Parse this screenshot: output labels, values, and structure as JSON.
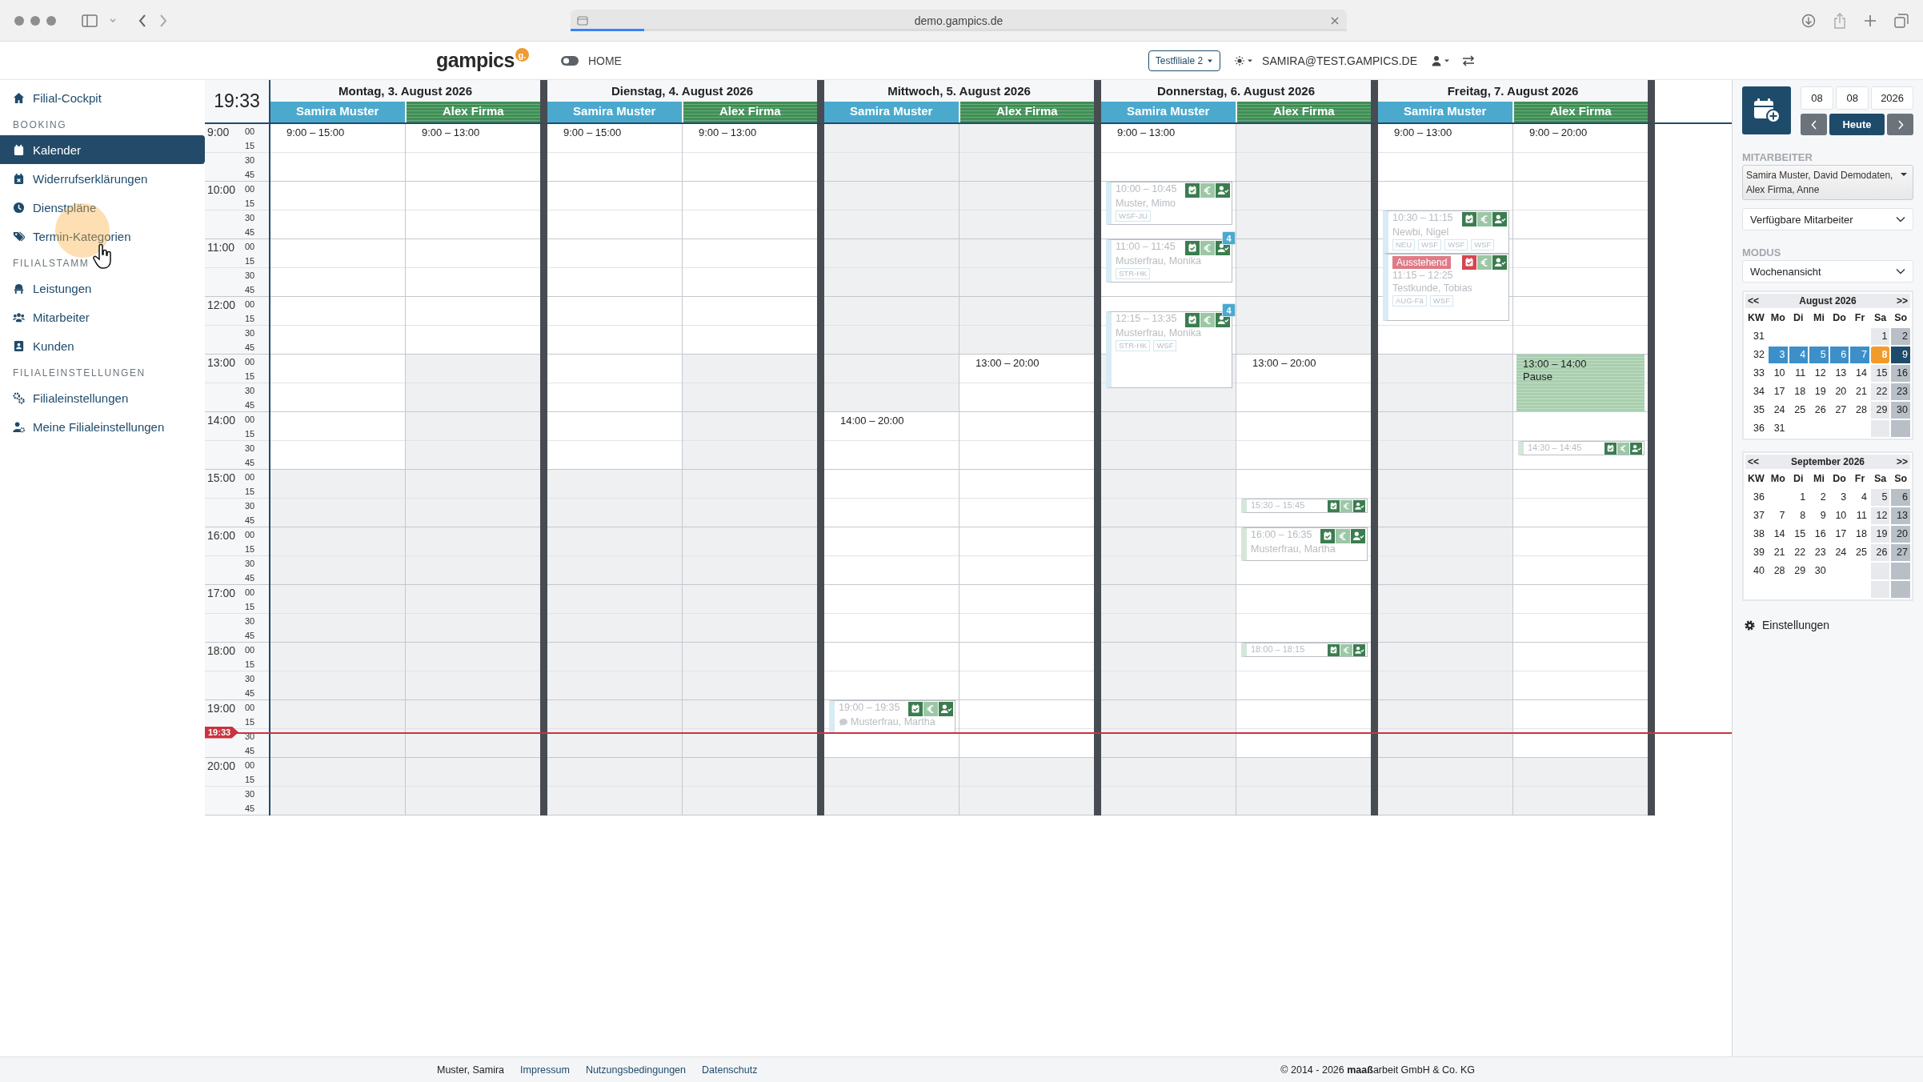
{
  "browser": {
    "url": "demo.gampics.de",
    "loading": {
      "level": 0.095
    }
  },
  "header": {
    "logo": "gampics",
    "logo_badge": "g.",
    "toggle_on": false,
    "mode_label": "HOME",
    "branch": "Testfiliale 2",
    "user": "SAMIRA@TEST.GAMPICS.DE"
  },
  "sidebar": {
    "items": [
      {
        "kind": "link",
        "label": "Filial-Cockpit",
        "selected": false
      },
      {
        "kind": "section",
        "label": "BOOKING"
      },
      {
        "kind": "link",
        "label": "Kalender",
        "selected": true
      },
      {
        "kind": "link",
        "label": "Widerrufserklärungen",
        "selected": false
      },
      {
        "kind": "link",
        "label": "Dienstpläne",
        "selected": false
      },
      {
        "kind": "link",
        "label": "Termin-Kategorien",
        "selected": false
      },
      {
        "kind": "section",
        "label": "FILIALSTAMM"
      },
      {
        "kind": "link",
        "label": "Leistungen",
        "selected": false
      },
      {
        "kind": "link",
        "label": "Mitarbeiter",
        "selected": false
      },
      {
        "kind": "link",
        "label": "Kunden",
        "selected": false
      },
      {
        "kind": "section",
        "label": "FILIALEINSTELLUNGEN"
      },
      {
        "kind": "link",
        "label": "Filialeinstellungen",
        "selected": false
      },
      {
        "kind": "link",
        "label": "Meine Filialeinstellungen",
        "selected": false
      }
    ]
  },
  "calendar": {
    "now": "19:33",
    "now_marker": "19:33",
    "hours": [
      {
        "label": "9:00",
        "quarters": [
          "00",
          "15",
          "30",
          "45"
        ]
      },
      {
        "label": "10:00",
        "quarters": [
          "00",
          "15",
          "30",
          "45"
        ]
      },
      {
        "label": "11:00",
        "quarters": [
          "00",
          "15",
          "30",
          "45"
        ]
      },
      {
        "label": "12:00",
        "quarters": [
          "00",
          "15",
          "30",
          "45"
        ]
      },
      {
        "label": "13:00",
        "quarters": [
          "00",
          "15",
          "30",
          "45"
        ]
      },
      {
        "label": "14:00",
        "quarters": [
          "00",
          "15",
          "30",
          "45"
        ]
      },
      {
        "label": "15:00",
        "quarters": [
          "00",
          "15",
          "30",
          "45"
        ]
      },
      {
        "label": "16:00",
        "quarters": [
          "00",
          "15",
          "30",
          "45"
        ]
      },
      {
        "label": "17:00",
        "quarters": [
          "00",
          "15",
          "30",
          "45"
        ]
      },
      {
        "label": "18:00",
        "quarters": [
          "00",
          "15",
          "30",
          "45"
        ]
      },
      {
        "label": "19:00",
        "quarters": [
          "00",
          "15",
          "30",
          "45"
        ]
      },
      {
        "label": "20:00",
        "quarters": [
          "00",
          "15",
          "30",
          "45"
        ]
      }
    ],
    "days": [
      {
        "title": "Montag, 3. August 2026",
        "lanes": [
          {
            "name": "Samira Muster",
            "color": "#4ba9cd",
            "striped": false,
            "availability": "9:00 – 15:00"
          },
          {
            "name": "Alex Firma",
            "color": "#3f8f55",
            "striped": true,
            "availability": "9:00 – 13:00"
          }
        ]
      },
      {
        "title": "Dienstag, 4. August 2026",
        "lanes": [
          {
            "name": "Samira Muster",
            "color": "#4ba9cd",
            "striped": false,
            "availability": "9:00 – 15:00"
          },
          {
            "name": "Alex Firma",
            "color": "#3f8f55",
            "striped": true,
            "availability": "9:00 – 13:00"
          }
        ]
      },
      {
        "title": "Mittwoch, 5. August 2026",
        "lanes": [
          {
            "name": "Samira Muster",
            "color": "#4ba9cd",
            "striped": false,
            "availability": "14:00 – 20:00",
            "appointments": [
              {
                "kind": "appointment",
                "time": "19:00 – 19:35",
                "client": "Musterfrau, Martha",
                "confirmed": true,
                "comment": true
              }
            ]
          },
          {
            "name": "Alex Firma",
            "color": "#3f8f55",
            "striped": true,
            "availability": "13:00 – 20:00"
          }
        ]
      },
      {
        "title": "Donnerstag, 6. August 2026",
        "lanes": [
          {
            "name": "Samira Muster",
            "color": "#4ba9cd",
            "striped": false,
            "availability": "9:00 – 13:00",
            "appointments": [
              {
                "kind": "appointment",
                "time": "10:00 – 10:45",
                "client": "Muster, Mimo",
                "tags": [
                  "WSF-JU"
                ],
                "confirmed": true,
                "comment": false
              },
              {
                "kind": "appointment",
                "time": "11:00 – 11:45",
                "client": "Musterfrau, Monika",
                "tags": [
                  "STR-HK"
                ],
                "confirmed": true,
                "comment": false,
                "badge": "4"
              },
              {
                "kind": "appointment",
                "time": "12:15 – 13:35",
                "client": "Musterfrau, Monika",
                "tags": [
                  "STR-HK",
                  "WSF"
                ],
                "confirmed": true,
                "comment": false,
                "badge": "4"
              }
            ]
          },
          {
            "name": "Alex Firma",
            "color": "#3f8f55",
            "striped": true,
            "availability": "13:00 – 20:00",
            "appointments": [
              {
                "kind": "appointment",
                "time": "15:30 – 15:45",
                "confirmed": true,
                "comment": false
              },
              {
                "kind": "appointment",
                "time": "16:00 – 16:35",
                "client": "Musterfrau, Martha",
                "confirmed": true,
                "comment": false
              },
              {
                "kind": "appointment",
                "time": "18:00 – 18:15",
                "confirmed": true,
                "comment": false
              }
            ]
          }
        ]
      },
      {
        "title": "Freitag, 7. August 2026",
        "lanes": [
          {
            "name": "Samira Muster",
            "color": "#4ba9cd",
            "striped": false,
            "availability": "9:00 – 13:00",
            "appointments": [
              {
                "kind": "appointment",
                "time": "10:30 – 11:15",
                "client": "Newbi, Nigel",
                "tags": [
                  "NEU",
                  "WSF",
                  "WSF",
                  "WSF"
                ],
                "confirmed": true,
                "comment": false
              },
              {
                "kind": "appointment",
                "time": "11:15 – 12:25",
                "client": "Testkunde, Tobias",
                "tags": [
                  "AUG-Fä",
                  "WSF"
                ],
                "confirmed": false,
                "comment": false,
                "status_label": "Ausstehend"
              }
            ]
          },
          {
            "name": "Alex Firma",
            "color": "#3f8f55",
            "striped": true,
            "availability": "9:00 – 20:00",
            "appointments": [
              {
                "kind": "break",
                "time": "13:00 – 14:00",
                "label": "Pause"
              },
              {
                "kind": "appointment",
                "time": "14:30 – 14:45",
                "confirmed": true,
                "comment": false
              }
            ]
          }
        ]
      }
    ]
  },
  "panel": {
    "date": [
      "08",
      "08",
      "2026"
    ],
    "today_button": "Heute",
    "staff_label": "MITARBEITER",
    "staff_value": "Samira Muster, David Demodaten, Alex Firma, Anne",
    "availability_select": "Verfügbare Mitarbeiter",
    "mode_label": "MODUS",
    "mode_select": "Wochenansicht",
    "months": [
      {
        "title": "August 2026",
        "prev": "<<",
        "next": ">>",
        "headers": [
          "KW",
          "Mo",
          "Di",
          "Mi",
          "Do",
          "Fr",
          "Sa",
          "So"
        ],
        "weeks": [
          {
            "kw": "31",
            "kind": "first",
            "selected": false,
            "days": [
              {
                "day": "1",
                "today": false
              },
              {
                "day": "2",
                "today": false
              }
            ]
          },
          {
            "kw": "32",
            "kind": "full",
            "selected": true,
            "days": [
              {
                "day": "3",
                "today": false
              },
              {
                "day": "4",
                "today": false
              },
              {
                "day": "5",
                "today": false
              },
              {
                "day": "6",
                "today": false
              },
              {
                "day": "7",
                "today": false
              },
              {
                "day": "8",
                "today": true
              },
              {
                "day": "9",
                "today": false
              }
            ]
          },
          {
            "kw": "33",
            "kind": "full",
            "selected": false,
            "days": [
              {
                "day": "10",
                "today": false
              },
              {
                "day": "11",
                "today": false
              },
              {
                "day": "12",
                "today": false
              },
              {
                "day": "13",
                "today": false
              },
              {
                "day": "14",
                "today": false
              },
              {
                "day": "15",
                "today": false
              },
              {
                "day": "16",
                "today": false
              }
            ]
          },
          {
            "kw": "34",
            "kind": "full",
            "selected": false,
            "days": [
              {
                "day": "17",
                "today": false
              },
              {
                "day": "18",
                "today": false
              },
              {
                "day": "19",
                "today": false
              },
              {
                "day": "20",
                "today": false
              },
              {
                "day": "21",
                "today": false
              },
              {
                "day": "22",
                "today": false
              },
              {
                "day": "23",
                "today": false
              }
            ]
          },
          {
            "kw": "35",
            "kind": "full",
            "selected": false,
            "days": [
              {
                "day": "24",
                "today": false
              },
              {
                "day": "25",
                "today": false
              },
              {
                "day": "26",
                "today": false
              },
              {
                "day": "27",
                "today": false
              },
              {
                "day": "28",
                "today": false
              },
              {
                "day": "29",
                "today": false
              },
              {
                "day": "30",
                "today": false
              }
            ]
          },
          {
            "kw": "36",
            "kind": "last",
            "selected": false,
            "days": [
              {
                "day": "31",
                "today": false
              }
            ]
          }
        ]
      },
      {
        "title": "September 2026",
        "prev": "<<",
        "next": ">>",
        "headers": [
          "KW",
          "Mo",
          "Di",
          "Mi",
          "Do",
          "Fr",
          "Sa",
          "So"
        ],
        "weeks": [
          {
            "kw": "36",
            "kind": "first",
            "selected": false,
            "days": [
              {
                "day": "1",
                "today": false
              },
              {
                "day": "2",
                "today": false
              },
              {
                "day": "3",
                "today": false
              },
              {
                "day": "4",
                "today": false
              },
              {
                "day": "5",
                "today": false
              },
              {
                "day": "6",
                "today": false
              }
            ]
          },
          {
            "kw": "37",
            "kind": "full",
            "selected": false,
            "days": [
              {
                "day": "7",
                "today": false
              },
              {
                "day": "8",
                "today": false
              },
              {
                "day": "9",
                "today": false
              },
              {
                "day": "10",
                "today": false
              },
              {
                "day": "11",
                "today": false
              },
              {
                "day": "12",
                "today": false
              },
              {
                "day": "13",
                "today": false
              }
            ]
          },
          {
            "kw": "38",
            "kind": "full",
            "selected": false,
            "days": [
              {
                "day": "14",
                "today": false
              },
              {
                "day": "15",
                "today": false
              },
              {
                "day": "16",
                "today": false
              },
              {
                "day": "17",
                "today": false
              },
              {
                "day": "18",
                "today": false
              },
              {
                "day": "19",
                "today": false
              },
              {
                "day": "20",
                "today": false
              }
            ]
          },
          {
            "kw": "39",
            "kind": "full",
            "selected": false,
            "days": [
              {
                "day": "21",
                "today": false
              },
              {
                "day": "22",
                "today": false
              },
              {
                "day": "23",
                "today": false
              },
              {
                "day": "24",
                "today": false
              },
              {
                "day": "25",
                "today": false
              },
              {
                "day": "26",
                "today": false
              },
              {
                "day": "27",
                "today": false
              }
            ]
          },
          {
            "kw": "40",
            "kind": "last",
            "selected": false,
            "days": [
              {
                "day": "28",
                "today": false
              },
              {
                "day": "29",
                "today": false
              },
              {
                "day": "30",
                "today": false
              }
            ]
          }
        ]
      }
    ],
    "settings": "Einstellungen"
  },
  "footer": {
    "user": "Muster, Samira",
    "links": [
      "Impressum",
      "Nutzungsbedingungen",
      "Datenschutz"
    ],
    "copyright": "© 2014 - 2026 **maaß**arbeit GmbH & Co. KG"
  }
}
